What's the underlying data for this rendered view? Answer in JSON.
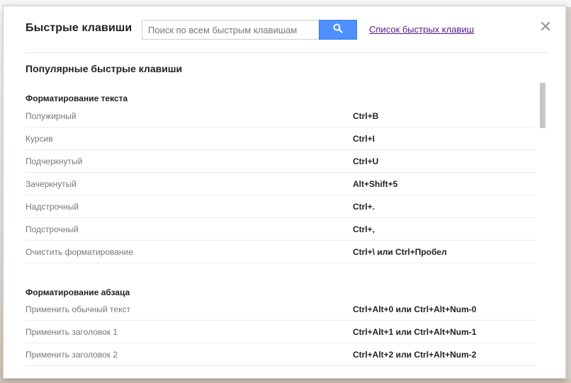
{
  "dialog": {
    "title": "Быстрые клавиши",
    "search": {
      "placeholder": "Поиск по всем быстрым клавишам",
      "value": ""
    },
    "shortcut_list_link": "Список быстрых клавиш",
    "popular_title": "Популярные быстрые клавиши"
  },
  "sections": [
    {
      "title": "Форматирование текста",
      "rows": [
        {
          "label": "Полужирный",
          "keys": "Ctrl+B"
        },
        {
          "label": "Курсив",
          "keys": "Ctrl+I"
        },
        {
          "label": "Подчеркнутый",
          "keys": "Ctrl+U"
        },
        {
          "label": "Зачеркнутый",
          "keys": "Alt+Shift+5"
        },
        {
          "label": "Надстрочный",
          "keys": "Ctrl+."
        },
        {
          "label": "Подстрочный",
          "keys": "Ctrl+,"
        },
        {
          "label": "Очистить форматирование",
          "keys": "Ctrl+\\ или Ctrl+Пробел"
        }
      ]
    },
    {
      "title": "Форматирование абзаца",
      "rows": [
        {
          "label": "Применить обычный текст",
          "keys": "Ctrl+Alt+0 или Ctrl+Alt+Num-0"
        },
        {
          "label": "Применить заголовок 1",
          "keys": "Ctrl+Alt+1 или Ctrl+Alt+Num-1"
        },
        {
          "label": "Применить заголовок 2",
          "keys": "Ctrl+Alt+2 или Ctrl+Alt+Num-2"
        }
      ]
    }
  ],
  "icons": {
    "search": "search-icon",
    "close": "close-icon"
  },
  "colors": {
    "accent_blue": "#4d90fe",
    "link_purple": "#551a8b",
    "muted_text": "#777777",
    "primary_text": "#222222"
  }
}
